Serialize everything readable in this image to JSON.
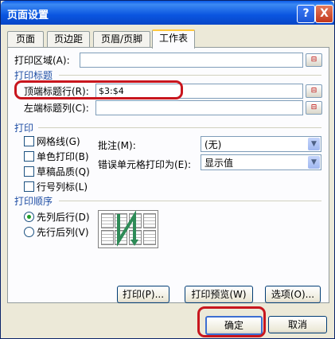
{
  "window": {
    "title": "页面设置",
    "help": "?",
    "close": "X"
  },
  "tabs": [
    "页面",
    "页边距",
    "页眉/页脚",
    "工作表"
  ],
  "print_area": {
    "label": "打印区域(A):",
    "value": ""
  },
  "print_titles": {
    "section": "打印标题",
    "rows_label": "顶端标题行(R):",
    "rows_value": "$3:$4",
    "cols_label": "左端标题列(C):",
    "cols_value": ""
  },
  "print": {
    "section": "打印",
    "gridlines": "网格线(G)",
    "mono": "单色打印(B)",
    "draft": "草稿品质(Q)",
    "headings": "行号列标(L)",
    "comments_label": "批注(M):",
    "comments_value": "(无)",
    "errors_label": "错误单元格打印为(E):",
    "errors_value": "显示值"
  },
  "order": {
    "section": "打印顺序",
    "down_then_over": "先列后行(D)",
    "over_then_down": "先行后列(V)"
  },
  "buttons": {
    "print": "打印(P)...",
    "preview": "打印预览(W)",
    "options": "选项(O)...",
    "ok": "确定",
    "cancel": "取消"
  },
  "colors": {
    "title_bar": "#0a55e0",
    "annotation": "#c8161e",
    "section_text": "#1f4ea4"
  }
}
